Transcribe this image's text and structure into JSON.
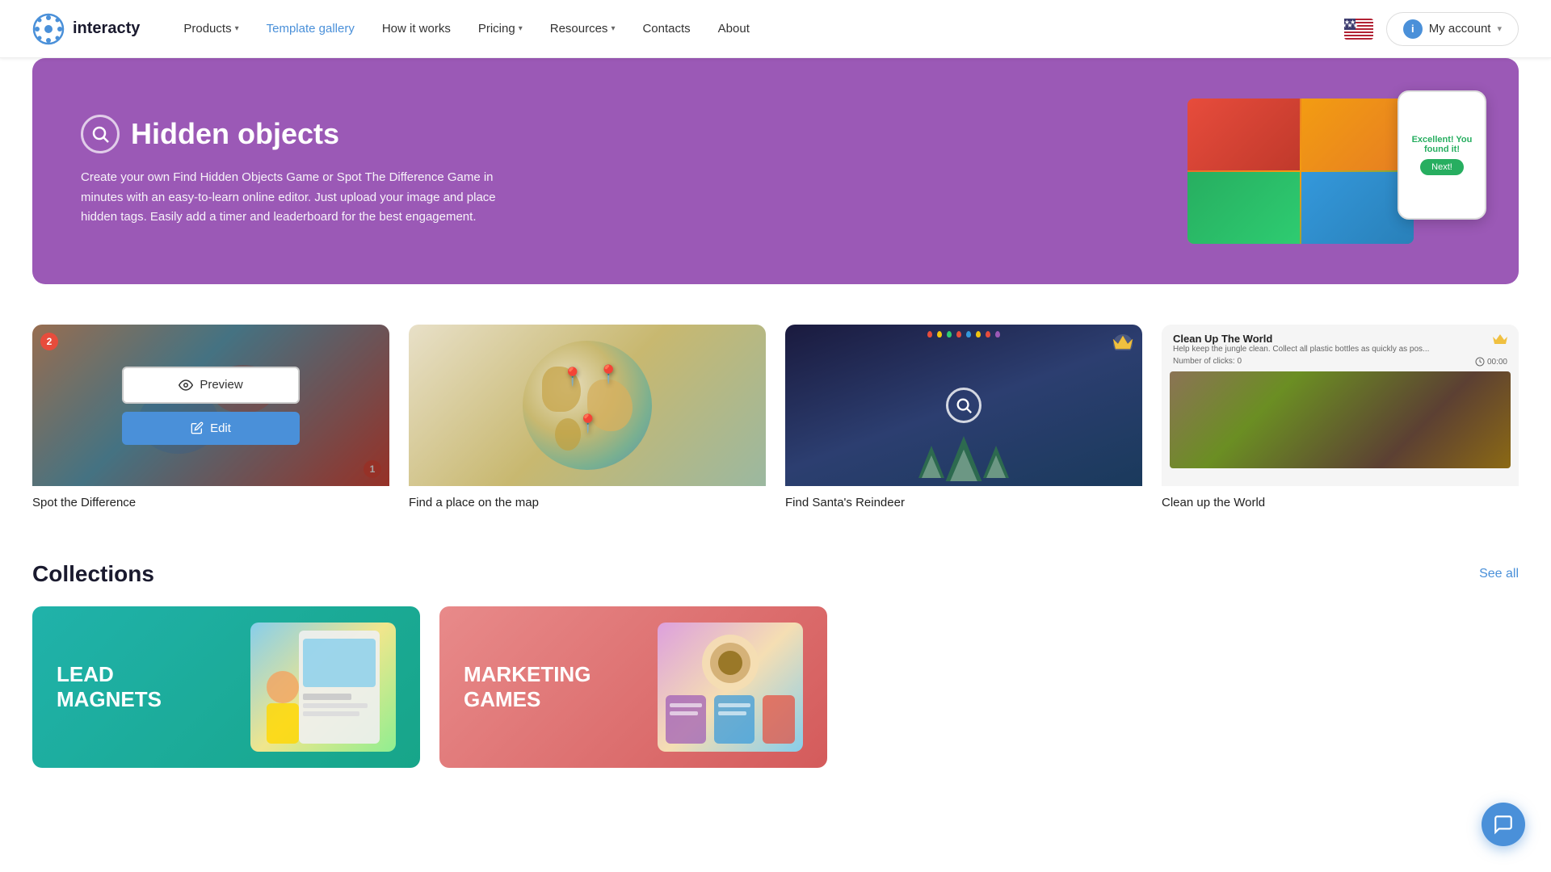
{
  "navbar": {
    "logo_text": "interacty",
    "nav_items": [
      {
        "label": "Products",
        "has_dropdown": true,
        "active": false
      },
      {
        "label": "Template gallery",
        "has_dropdown": false,
        "active": true
      },
      {
        "label": "How it works",
        "has_dropdown": false,
        "active": false
      },
      {
        "label": "Pricing",
        "has_dropdown": true,
        "active": false
      },
      {
        "label": "Resources",
        "has_dropdown": true,
        "active": false
      },
      {
        "label": "Contacts",
        "has_dropdown": false,
        "active": false
      },
      {
        "label": "About",
        "has_dropdown": false,
        "active": false
      }
    ],
    "my_account_label": "My account",
    "flag_alt": "US Flag"
  },
  "hero": {
    "title": "Hidden objects",
    "description": "Create your own Find Hidden Objects Game or Spot The Difference Game in minutes with an easy-to-learn online editor. Just upload your image and place hidden tags. Easily add a timer and leaderboard for the best engagement.",
    "phone_found_label": "Excellent! You found it!",
    "phone_btn_label": "Next!"
  },
  "template_cards": [
    {
      "label": "Spot the Difference",
      "type": "spot-diff",
      "badge": "2",
      "badge2": "1"
    },
    {
      "label": "Find a place on the map",
      "type": "map"
    },
    {
      "label": "Find Santa's Reindeer",
      "type": "reindeer",
      "has_crown": true
    },
    {
      "label": "Clean up the World",
      "type": "world",
      "has_crown": true,
      "world_title": "Clean Up The World",
      "world_subtitle": "Help keep the jungle clean. Collect all plastic bottles as quickly as pos...",
      "world_clicks": "Number of clicks: 0",
      "world_time": "00:00"
    }
  ],
  "actions": {
    "preview_label": "Preview",
    "edit_label": "Edit"
  },
  "collections": {
    "title": "Collections",
    "see_all_label": "See all",
    "items": [
      {
        "label": "LEAD\nMAGNETS",
        "type": "lead"
      },
      {
        "label": "MARKETING\nGAMES",
        "type": "marketing"
      }
    ]
  }
}
